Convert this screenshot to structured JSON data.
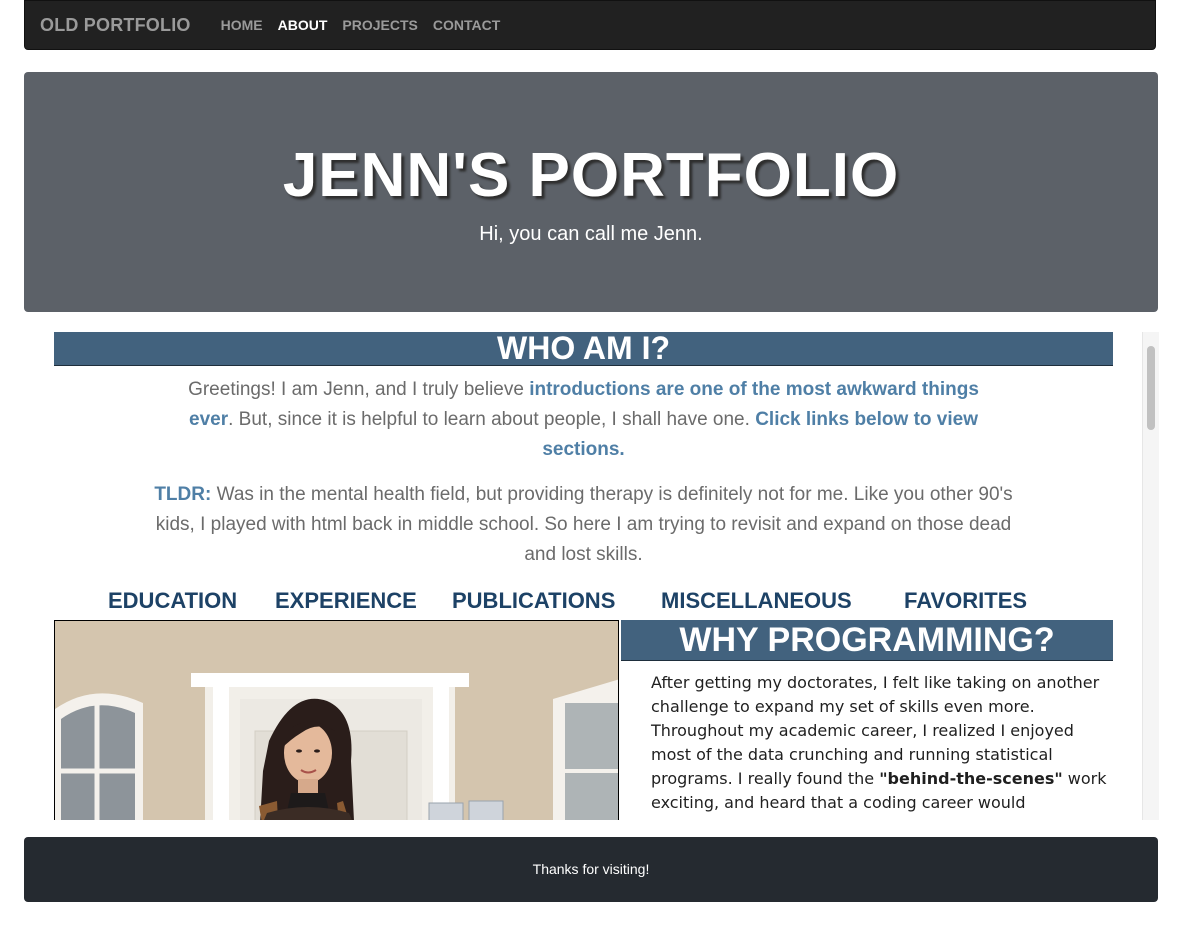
{
  "navbar": {
    "brand": "OLD PORTFOLIO",
    "links": [
      "HOME",
      "ABOUT",
      "PROJECTS",
      "CONTACT"
    ],
    "active": "ABOUT"
  },
  "hero": {
    "title": "JENN'S PORTFOLIO",
    "subtitle": "Hi, you can call me Jenn."
  },
  "who": {
    "heading": "WHO AM I?",
    "intro_1": "Greetings! I am Jenn, and I truly believe ",
    "intro_link": "introductions are one of the most awkward things ever",
    "intro_2": ". But, since it is helpful to learn about people, I shall have one. ",
    "intro_cta": "Click links below to view sections.",
    "tldr_label": "TLDR:",
    "tldr_text": " Was in the mental health field, but providing therapy is definitely not for me. Like you other 90's kids, I played with html back in middle school. So here I am trying to revisit and expand on those dead and lost skills."
  },
  "sections": [
    "EDUCATION",
    "EXPERIENCE",
    "PUBLICATIONS",
    "MISCELLANEOUS",
    "FAVORITES"
  ],
  "why": {
    "heading": "WHY PROGRAMMING?",
    "text_1": "After getting my doctorates, I felt like taking on another challenge to expand my set of skills even more. Throughout my academic career, I realized I enjoyed most of the data crunching and running statistical programs. I really found the ",
    "text_bold": "\"behind-the-scenes\"",
    "text_2": " work exciting, and heard that a coding career would encompass a similar type of workstyle. Back in middle school, I would design tons of websites for fun and edit"
  },
  "footer": {
    "text": "Thanks for visiting!"
  },
  "colors": {
    "navbar": "#212121",
    "hero": "#5c6168",
    "section_header": "#42627e",
    "link": "#4f7fa6",
    "footer": "#252a30"
  }
}
